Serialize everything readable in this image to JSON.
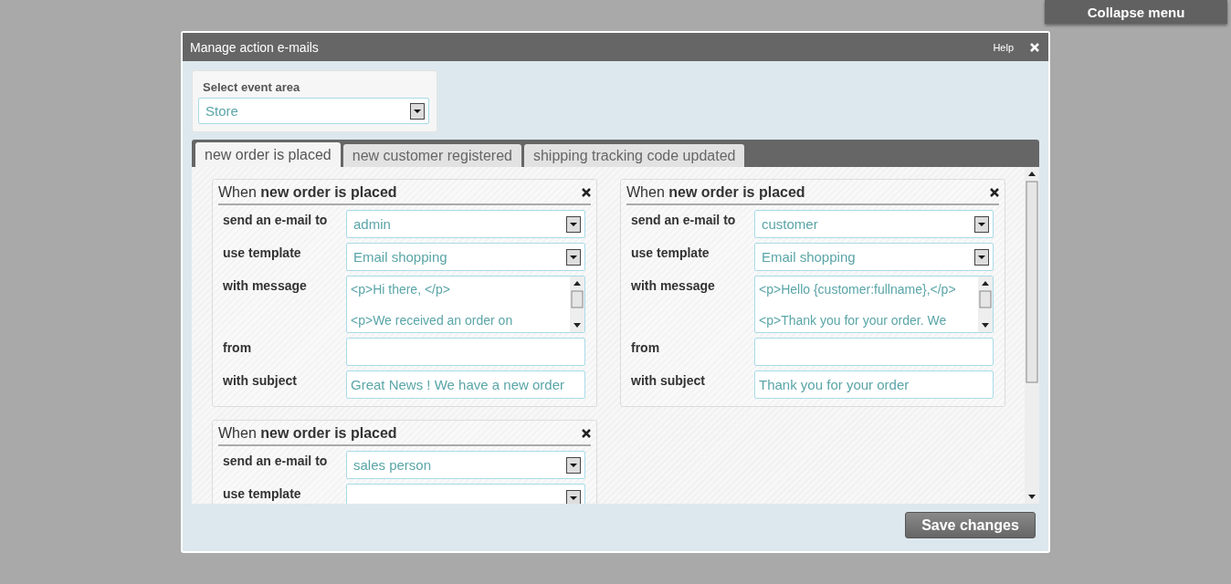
{
  "page": {
    "collapse_button": "Collapse menu"
  },
  "dialog": {
    "title": "Manage action e-mails",
    "help": "Help"
  },
  "event_area": {
    "label": "Select event area",
    "value": "Store"
  },
  "tabs": [
    {
      "label": "new order is placed",
      "selected": true
    },
    {
      "label": "new customer registered",
      "selected": false
    },
    {
      "label": "shipping tracking code updated",
      "selected": false
    }
  ],
  "cards": [
    {
      "title": "When **new order is placed**",
      "fields": [
        {
          "kind": "select",
          "label": "send an e-mail to",
          "value": "admin"
        },
        {
          "kind": "select",
          "label": "use template",
          "value": "Email shopping"
        },
        {
          "kind": "textarea",
          "label": "with message",
          "lines": [
            "<p>Hi there, </p>",
            "<p>We received an order on"
          ]
        },
        {
          "kind": "input",
          "label": "from"
        },
        {
          "kind": "input",
          "label": "with subject",
          "value": "Great News ! We have a new order"
        }
      ]
    },
    {
      "title": "When **new order is placed**",
      "fields": [
        {
          "kind": "select",
          "label": "send an e-mail to",
          "value": "customer"
        },
        {
          "kind": "select",
          "label": "use template",
          "value": "Email shopping"
        },
        {
          "kind": "textarea",
          "label": "with message",
          "lines": [
            "<p>Hello {customer:fullname},</p>",
            "<p>Thank you for your order. We"
          ]
        },
        {
          "kind": "input",
          "label": "from"
        },
        {
          "kind": "input",
          "label": "with subject",
          "value": "Thank you for your order"
        }
      ]
    },
    {
      "title": "When **new order is placed**",
      "fields": [
        {
          "kind": "select",
          "label": "send an e-mail to",
          "value": "sales person"
        },
        {
          "kind": "select",
          "label": "use template"
        }
      ]
    }
  ],
  "save_button": "Save changes"
}
